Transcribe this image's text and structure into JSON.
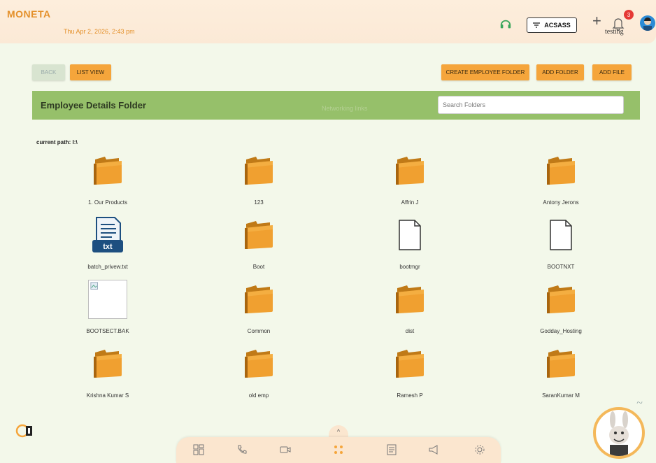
{
  "header": {
    "logo": "MONETA",
    "datetime": "Thu Apr 2, 2026, 2:43 pm",
    "company_button": "ACSASS",
    "notification_count": "3",
    "username": "testing",
    "colors": {
      "accent": "#f5a53b",
      "header_bar": "#96c06a",
      "background": "#f3f8ea"
    }
  },
  "toolbar": {
    "back_label": "BACK",
    "list_view_label": "LIST VIEW",
    "create_employee_folder_label": "CREATE EMPLOYEE FOLDER",
    "add_folder_label": "ADD FOLDER",
    "add_file_label": "ADD FILE"
  },
  "panel": {
    "title": "Employee Details Folder",
    "faded_label": "Networking links",
    "search_placeholder": "Search Folders"
  },
  "path_label": "current path: I:\\",
  "items": [
    {
      "name": "1. Our Products",
      "type": "folder"
    },
    {
      "name": "123",
      "type": "folder"
    },
    {
      "name": "Affrin J",
      "type": "folder"
    },
    {
      "name": "Antony Jerons",
      "type": "folder"
    },
    {
      "name": "batch_privew.txt",
      "type": "txt"
    },
    {
      "name": "Boot",
      "type": "folder"
    },
    {
      "name": "bootmgr",
      "type": "file"
    },
    {
      "name": "BOOTNXT",
      "type": "file"
    },
    {
      "name": "BOOTSECT.BAK",
      "type": "image"
    },
    {
      "name": "Common",
      "type": "folder"
    },
    {
      "name": "dist",
      "type": "folder"
    },
    {
      "name": "Godday_Hosting",
      "type": "folder"
    },
    {
      "name": "Krishna Kumar S",
      "type": "folder"
    },
    {
      "name": "old emp",
      "type": "folder"
    },
    {
      "name": "Ramesh P",
      "type": "folder"
    },
    {
      "name": "SaranKumar M",
      "type": "folder"
    }
  ],
  "txt_badge": "txt",
  "dock": {
    "icons": [
      "dashboard-icon",
      "phone-icon",
      "video-icon",
      "apps-icon",
      "document-icon",
      "megaphone-icon",
      "settings-icon"
    ]
  }
}
